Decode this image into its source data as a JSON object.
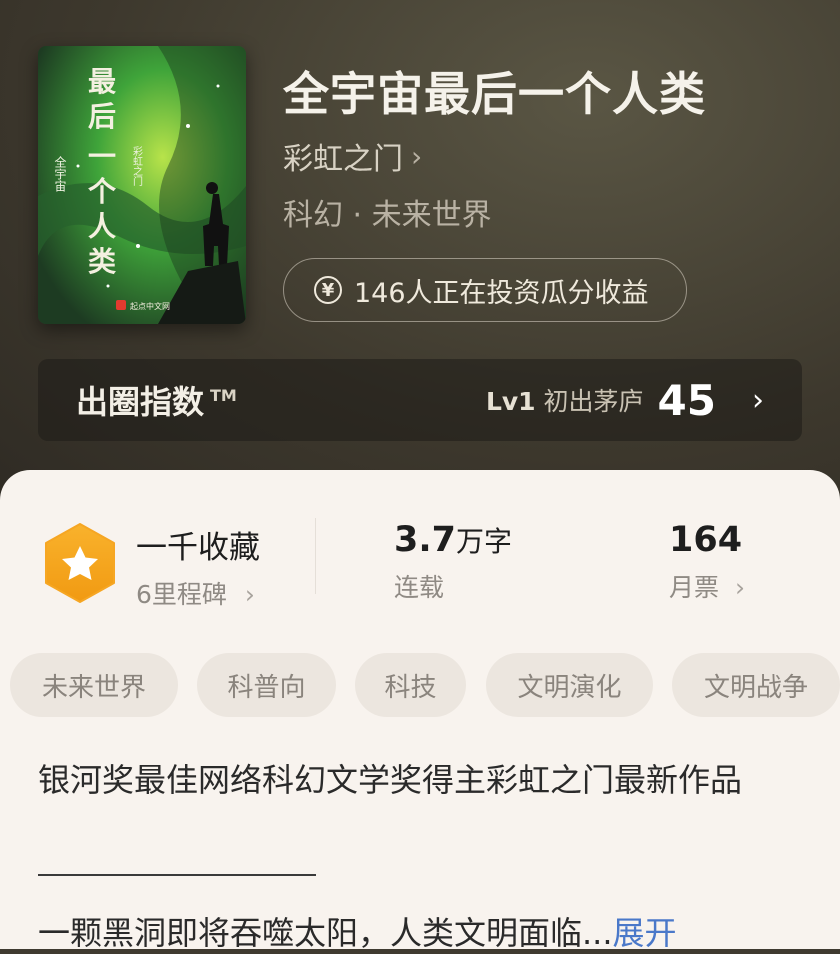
{
  "book": {
    "title": "全宇宙最后一个人类",
    "author": "彩虹之门",
    "author_chevron": "›",
    "genre": "科幻 · 未来世界",
    "investment_icon": "¥",
    "investment_text": "146人正在投资瓜分收益",
    "cover": {
      "title_chars": [
        "最",
        "后",
        "一",
        "个",
        "人",
        "类"
      ],
      "subtitle": "全宇宙",
      "author_vertical": "彩虹之门",
      "publisher": "起点中文网"
    }
  },
  "popularity_index": {
    "label": "出圈指数",
    "tm": "TM",
    "level_code": "Lv1",
    "level_name": "初出茅庐",
    "score": "45",
    "arrow": "›"
  },
  "stats": {
    "collection": {
      "title": "一千收藏",
      "subtitle": "6里程碑",
      "chevron": "›",
      "icon": "star-hexagon-icon"
    },
    "word_count": {
      "value": "3.7",
      "unit": "万字",
      "status": "连载"
    },
    "monthly_votes": {
      "value": "164",
      "label": "月票",
      "chevron": "›"
    }
  },
  "tags": [
    "未来世界",
    "科普向",
    "科技",
    "文明演化",
    "文明战争"
  ],
  "description": {
    "line1": "银河奖最佳网络科幻文学奖得主彩虹之门最新作品",
    "line2": "一颗黑洞即将吞噬太阳，人类文明面临...",
    "expand_label": "展开"
  },
  "colors": {
    "accent_orange": "#f6a623",
    "expand_link": "#4a78c9",
    "panel_bg": "#f8f3ee"
  }
}
